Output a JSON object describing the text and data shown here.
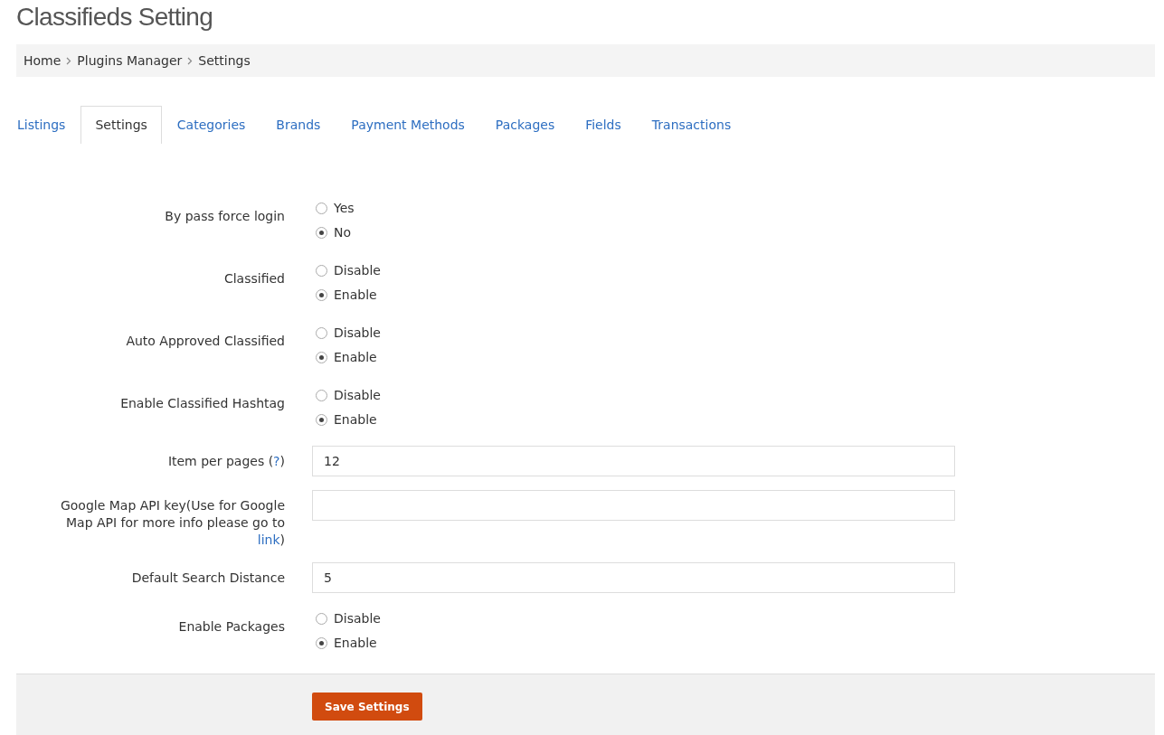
{
  "page_title": "Classifieds Setting",
  "breadcrumb": [
    "Home",
    "Plugins Manager",
    "Settings"
  ],
  "tabs": [
    {
      "label": "Listings",
      "selected": false
    },
    {
      "label": "Settings",
      "selected": true
    },
    {
      "label": "Categories",
      "selected": false
    },
    {
      "label": "Brands",
      "selected": false
    },
    {
      "label": "Payment Methods",
      "selected": false
    },
    {
      "label": "Packages",
      "selected": false
    },
    {
      "label": "Fields",
      "selected": false
    },
    {
      "label": "Transactions",
      "selected": false
    }
  ],
  "settings": [
    {
      "kind": "radio",
      "label": "By pass force login",
      "options": [
        {
          "label": "Yes",
          "selected": false
        },
        {
          "label": "No",
          "selected": true
        }
      ]
    },
    {
      "kind": "radio",
      "label": "Classified",
      "options": [
        {
          "label": "Disable",
          "selected": false
        },
        {
          "label": "Enable",
          "selected": true
        }
      ]
    },
    {
      "kind": "radio",
      "label": "Auto Approved Classified",
      "options": [
        {
          "label": "Disable",
          "selected": false
        },
        {
          "label": "Enable",
          "selected": true
        }
      ]
    },
    {
      "kind": "radio",
      "label": "Enable Classified Hashtag",
      "options": [
        {
          "label": "Disable",
          "selected": false
        },
        {
          "label": "Enable",
          "selected": true
        }
      ]
    },
    {
      "kind": "text",
      "label": "Item per pages (",
      "link": "?",
      "label_after": ")",
      "value": "12"
    },
    {
      "kind": "text",
      "label": "Google Map API key(Use for Google Map API for more info please go to ",
      "link": "link",
      "label_after": ")"
    },
    {
      "kind": "text",
      "label": "Default Search Distance",
      "value": "5"
    },
    {
      "kind": "radio",
      "label": "Enable Packages",
      "options": [
        {
          "label": "Disable",
          "selected": false
        },
        {
          "label": "Enable",
          "selected": true
        }
      ]
    }
  ],
  "save_button": "Save Settings"
}
